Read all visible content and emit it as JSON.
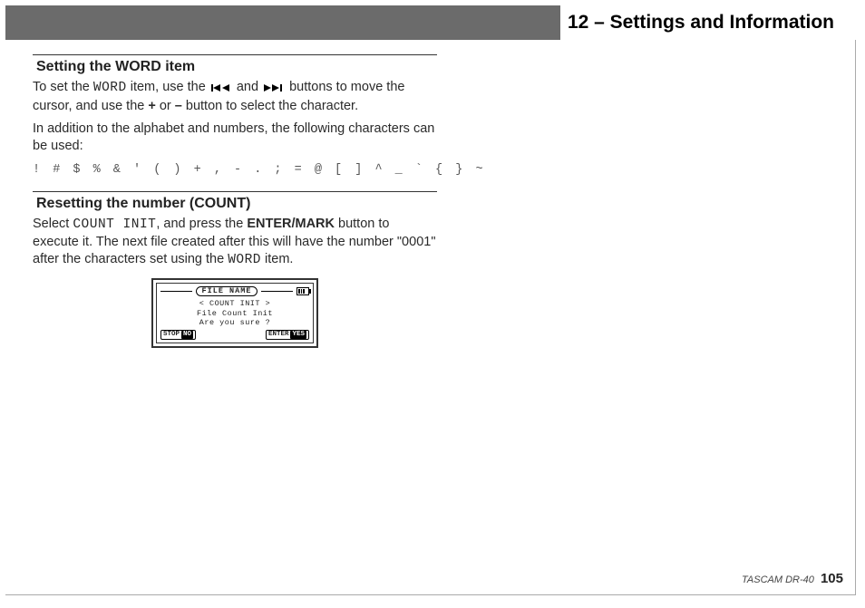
{
  "chapter_title": "12 – Settings and Information",
  "section1": {
    "heading": "Setting the WORD item",
    "p1_a": "To set the ",
    "p1_word": "WORD",
    "p1_b": " item, use the ",
    "p1_c": " and ",
    "p1_d": " buttons to move the cursor, and use the ",
    "p1_plus": "+",
    "p1_e": " or ",
    "p1_minus": "–",
    "p1_f": " button to select the character.",
    "p2": "In addition to the alphabet and numbers, the following characters can be used:",
    "specials": "! # $ % & ' ( ) + , - . ; = @ [ ] ^ _ ` { } ~"
  },
  "section2": {
    "heading": "Resetting the number (COUNT)",
    "p1_a": "Select ",
    "p1_mono": "COUNT INIT",
    "p1_b": ", and press the ",
    "p1_btn": "ENTER/MARK",
    "p1_c": " button to execute it. The next file created after this will have the number \"0001\" after the characters set using the ",
    "p1_word": "WORD",
    "p1_d": " item."
  },
  "lcd": {
    "title": "FILE NAME",
    "line1": "< COUNT INIT >",
    "line2": "File Count Init",
    "line3": "Are you sure ?",
    "btn_left_label": "STOP",
    "btn_left_action": "NO",
    "btn_right_label": "ENTER",
    "btn_right_action": "YES"
  },
  "footer": {
    "product": "TASCAM DR-40",
    "page": "105"
  },
  "icons": {
    "rew": "prev-icon",
    "ffwd": "next-icon"
  }
}
